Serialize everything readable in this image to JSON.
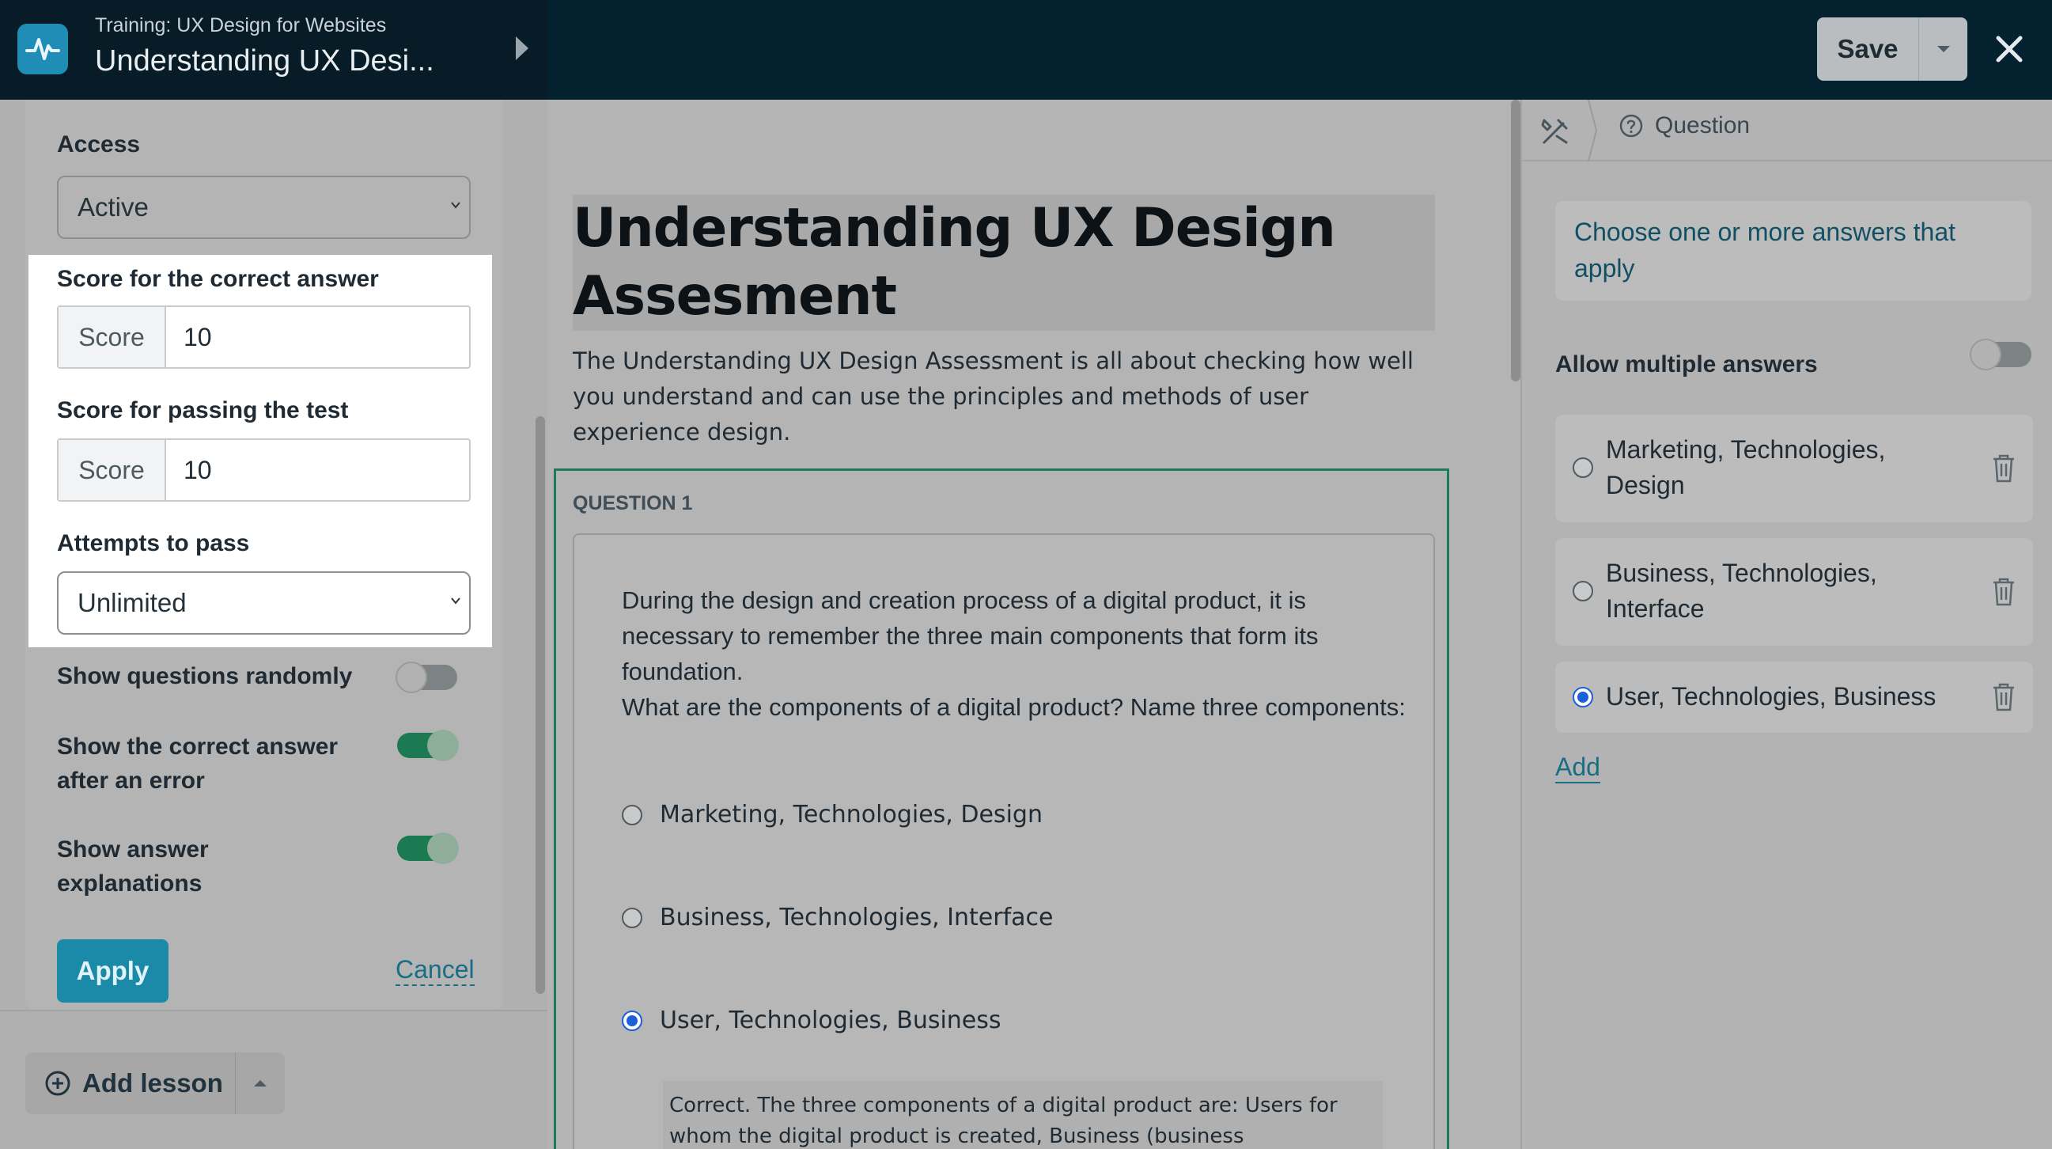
{
  "header": {
    "breadcrumb": "Training: UX Design for Websites",
    "lesson_title": "Understanding UX Desi...",
    "save_label": "Save",
    "colors": {
      "bar": "#04212f",
      "logo": "#1f8db5"
    }
  },
  "settings": {
    "access_label": "Access",
    "access_value": "Active",
    "score_correct_label": "Score for the correct answer",
    "score_correct_addon": "Score",
    "score_correct_value": "10",
    "score_pass_label": "Score for passing the test",
    "score_pass_addon": "Score",
    "score_pass_value": "10",
    "attempts_label": "Attempts to pass",
    "attempts_value": "Unlimited",
    "toggles": [
      {
        "label": "Show questions randomly",
        "on": false
      },
      {
        "label": "Show the correct answer after an error",
        "on": true
      },
      {
        "label": "Show answer explanations",
        "on": true
      }
    ],
    "apply_label": "Apply",
    "cancel_label": "Cancel",
    "accent": "#1a8aa8"
  },
  "lesson_bar": {
    "add_lesson_label": "Add lesson"
  },
  "document": {
    "title": "Understanding UX Design Assesment",
    "description": "The Understanding UX Design Assessment is all about checking how well you understand and can use the principles and methods of user experience design.",
    "question_label": "QUESTION 1",
    "question_text_1": "During the design and creation process of a digital product, it is necessary to remember the three main components that form its foundation.",
    "question_text_2": "What are the components of a digital product? Name three components:",
    "options": [
      {
        "label": "Marketing, Technologies, Design",
        "selected": false
      },
      {
        "label": "Business, Technologies, Interface",
        "selected": false
      },
      {
        "label": "User, Technologies, Business",
        "selected": true
      }
    ],
    "explanation": "Correct. The three components of a digital product are: Users for whom the digital product is created, Business (business requirements), and"
  },
  "right_panel": {
    "tab_label": "Question",
    "hint": "Choose one or more answers that apply",
    "allow_multiple_label": "Allow multiple answers",
    "allow_multiple_on": false,
    "answers": [
      {
        "label": "Marketing, Technologies, Design",
        "selected": false
      },
      {
        "label": "Business, Technologies, Interface",
        "selected": false
      },
      {
        "label": "User, Technologies, Business",
        "selected": true
      }
    ],
    "add_label": "Add"
  }
}
